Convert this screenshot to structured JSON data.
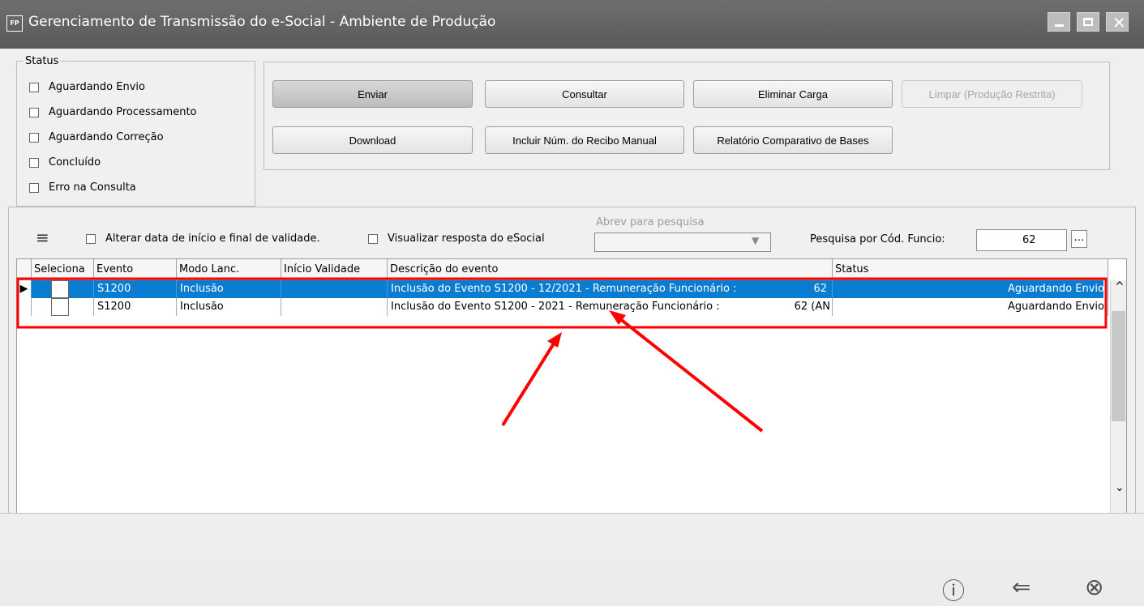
{
  "window": {
    "logo": "FP",
    "title": "Gerenciamento de Transmissão do e-Social - Ambiente de Produção"
  },
  "status_group": {
    "title": "Status",
    "items": [
      "Aguardando Envio",
      "Aguardando Processamento",
      "Aguardando Correção",
      "Concluído",
      "Erro na Consulta"
    ]
  },
  "actions": {
    "enviar": "Enviar",
    "consultar": "Consultar",
    "eliminar_carga": "Eliminar Carga",
    "limpar": "Limpar (Produção Restrita)",
    "download": "Download",
    "incluir_recibo": "Incluir Núm. do Recibo Manual",
    "relatorio": "Relatório Comparativo de Bases"
  },
  "filters": {
    "alterar_data": "Alterar data de início e final de validade.",
    "visualizar_resposta": "Visualizar resposta do eSocial",
    "abrev_label": "Abrev para pesquisa",
    "cod_label": "Pesquisa por Cód. Funcio:",
    "cod_value": "62"
  },
  "table": {
    "columns": [
      "Seleciona",
      "Evento",
      "Modo Lanc.",
      "Início Validade",
      "Descrição do evento",
      "Status"
    ],
    "rows": [
      {
        "evento": "S1200",
        "modo": "Inclusão",
        "inicio": "",
        "descricao": "Inclusão do Evento S1200 - 12/2021 - Remuneração Funcionário :",
        "desc_value": "62",
        "status": "Aguardando Envio"
      },
      {
        "evento": "S1200",
        "modo": "Inclusão",
        "inicio": "",
        "descricao": "Inclusão do Evento S1200 - 2021 - Remuneração Funcionário :",
        "desc_value": "62 (AN",
        "status": "Aguardando Envio"
      }
    ]
  },
  "colors": {
    "selected_row": "#0b7dd0",
    "annotation": "#ff0000"
  },
  "icons": [
    "help-icon",
    "back-arrow-icon",
    "close-circle-icon"
  ]
}
